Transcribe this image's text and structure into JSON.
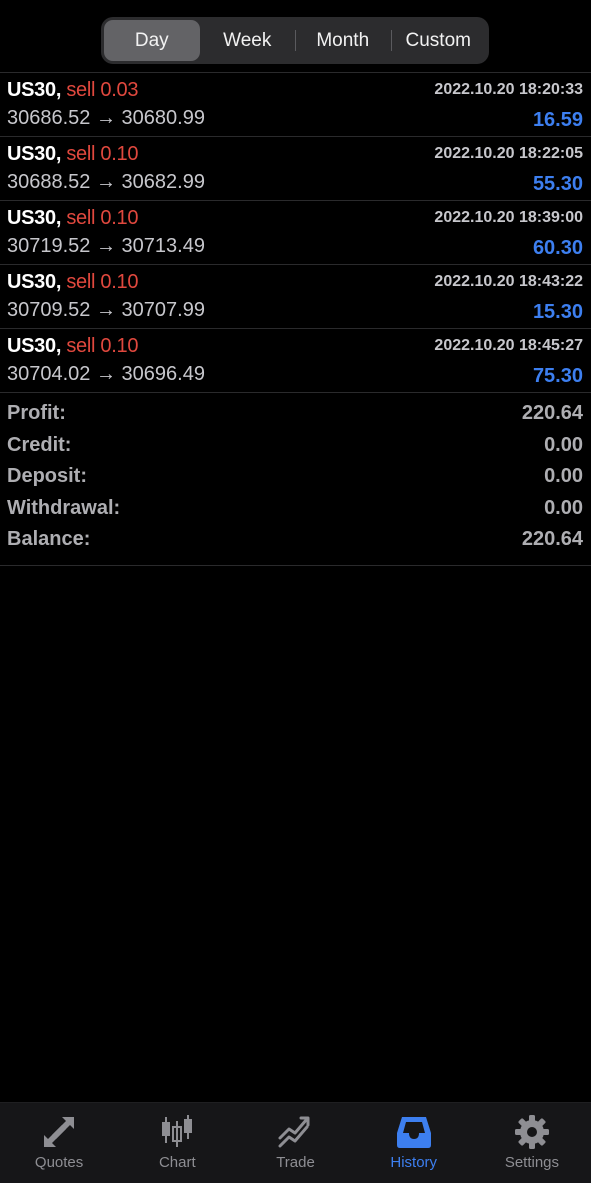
{
  "period_tabs": [
    {
      "label": "Day",
      "active": true
    },
    {
      "label": "Week",
      "active": false
    },
    {
      "label": "Month",
      "active": false
    },
    {
      "label": "Custom",
      "active": false
    }
  ],
  "deals": [
    {
      "symbol": "US30,",
      "side": "sell 0.03",
      "time": "2022.10.20 18:20:33",
      "prices": "30686.52 → 30680.99",
      "profit": "16.59"
    },
    {
      "symbol": "US30,",
      "side": "sell 0.10",
      "time": "2022.10.20 18:22:05",
      "prices": "30688.52 → 30682.99",
      "profit": "55.30"
    },
    {
      "symbol": "US30,",
      "side": "sell 0.10",
      "time": "2022.10.20 18:39:00",
      "prices": "30719.52 → 30713.49",
      "profit": "60.30"
    },
    {
      "symbol": "US30,",
      "side": "sell 0.10",
      "time": "2022.10.20 18:43:22",
      "prices": "30709.52 → 30707.99",
      "profit": "15.30"
    },
    {
      "symbol": "US30,",
      "side": "sell 0.10",
      "time": "2022.10.20 18:45:27",
      "prices": "30704.02 → 30696.49",
      "profit": "75.30"
    }
  ],
  "summary": {
    "profit": {
      "label": "Profit:",
      "value": "220.64"
    },
    "credit": {
      "label": "Credit:",
      "value": "0.00"
    },
    "deposit": {
      "label": "Deposit:",
      "value": "0.00"
    },
    "withdrawal": {
      "label": "Withdrawal:",
      "value": "0.00"
    },
    "balance": {
      "label": "Balance:",
      "value": "220.64"
    }
  },
  "tabbar": [
    {
      "label": "Quotes",
      "icon": "quotes-arrows-icon",
      "active": false
    },
    {
      "label": "Chart",
      "icon": "candlestick-chart-icon",
      "active": false
    },
    {
      "label": "Trade",
      "icon": "trade-trend-icon",
      "active": false
    },
    {
      "label": "History",
      "icon": "history-inbox-icon",
      "active": true
    },
    {
      "label": "Settings",
      "icon": "gear-icon",
      "active": false
    }
  ],
  "colors": {
    "background": "#000000",
    "sell": "#e0483e",
    "profit": "#3d7ff0",
    "active_tab": "#3d7ff0",
    "inactive_tab": "#8e8e93"
  }
}
